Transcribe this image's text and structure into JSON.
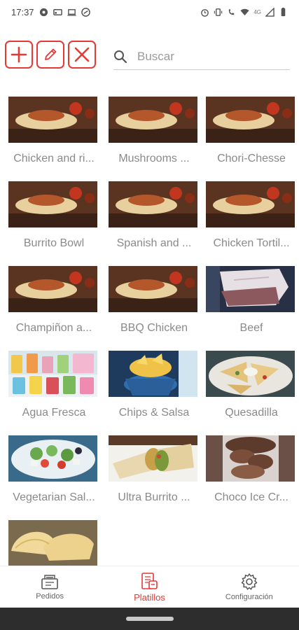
{
  "status_bar": {
    "time": "17:37",
    "left_icons": [
      "at-icon",
      "cast-icon",
      "laptop-icon",
      "vpn-icon"
    ],
    "right_icons": [
      "alarm-icon",
      "vibrate-icon",
      "wifi-calling-icon",
      "wifi-icon",
      "signal-icon",
      "battery-icon"
    ],
    "network_label": "4G"
  },
  "toolbar": {
    "add_icon": "plus-icon",
    "edit_icon": "pencil-icon",
    "delete_icon": "close-icon",
    "accent_color": "#e53935"
  },
  "search": {
    "placeholder": "Buscar",
    "value": "",
    "icon": "search-icon"
  },
  "dishes": [
    {
      "name": "Chicken and ri...",
      "image": "burrito-plate"
    },
    {
      "name": "Mushrooms ...",
      "image": "burrito-plate"
    },
    {
      "name": "Chori-Chesse",
      "image": "burrito-plate"
    },
    {
      "name": "Burrito Bowl",
      "image": "burrito-plate"
    },
    {
      "name": "Spanish and ...",
      "image": "burrito-plate"
    },
    {
      "name": "Chicken Tortil...",
      "image": "burrito-plate"
    },
    {
      "name": "Champiñon a...",
      "image": "burrito-plate"
    },
    {
      "name": "BBQ Chicken",
      "image": "burrito-plate"
    },
    {
      "name": "Beef",
      "image": "beef-slices"
    },
    {
      "name": "Agua Fresca",
      "image": "fruit-drinks"
    },
    {
      "name": "Chips & Salsa",
      "image": "chips-bowl"
    },
    {
      "name": "Quesadilla",
      "image": "quesadilla-plate"
    },
    {
      "name": "Vegetarian Sal...",
      "image": "salad-bowl"
    },
    {
      "name": "Ultra Burrito ...",
      "image": "burrito-cut"
    },
    {
      "name": "Choco Ice Cr...",
      "image": "ice-cream-cup"
    },
    {
      "name": "",
      "image": "empanadas"
    }
  ],
  "bottom_nav": {
    "items": [
      {
        "label": "Pedidos",
        "icon": "orders-icon",
        "active": false
      },
      {
        "label": "Platillos",
        "icon": "dishes-icon",
        "active": true
      },
      {
        "label": "Configuración",
        "icon": "gear-icon",
        "active": false
      }
    ]
  }
}
